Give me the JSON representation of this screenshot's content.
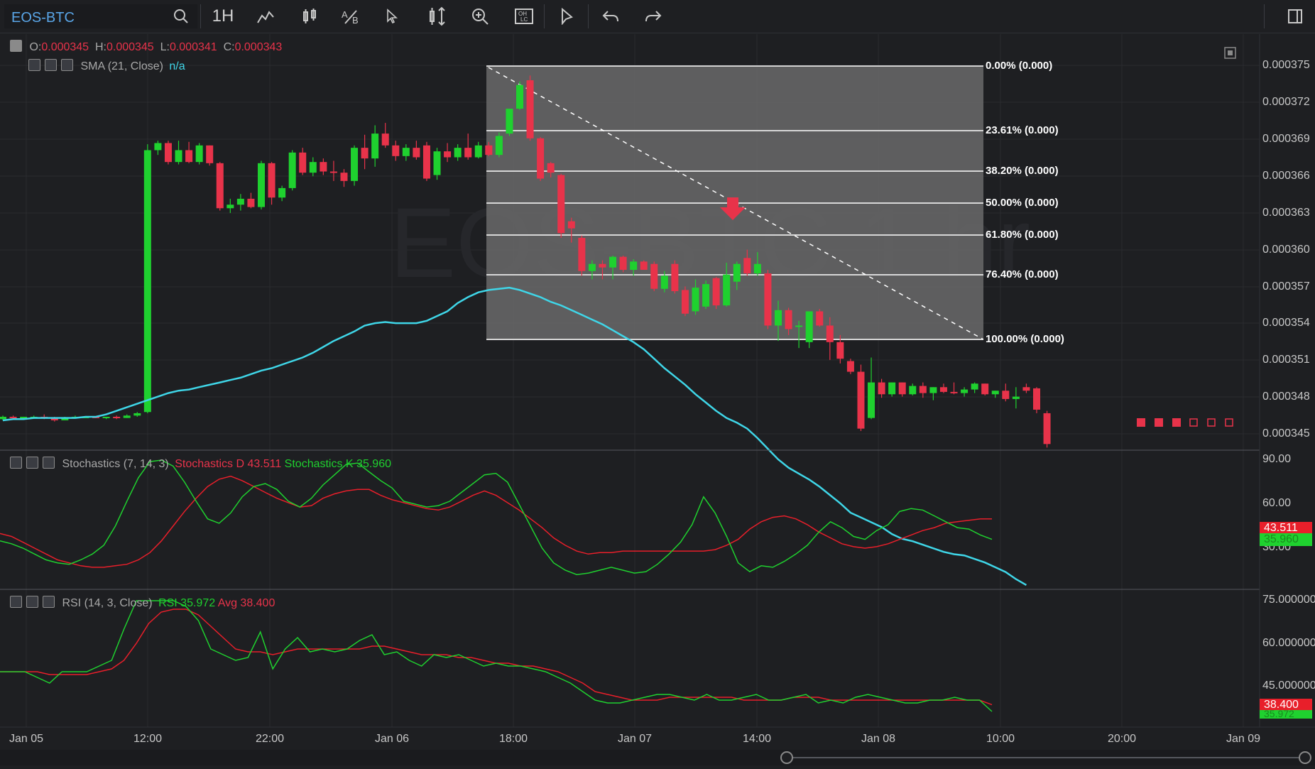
{
  "toolbar": {
    "symbol": "EOS-BTC",
    "interval": "1H",
    "icons": [
      "search-icon",
      "line-study-icon",
      "candle-style-icon",
      "text-annotation-icon",
      "cursor-icon",
      "y-scale-icon",
      "zoom-in-icon",
      "ohlc-icon",
      "pointer-icon",
      "undo-icon",
      "redo-icon",
      "fullscreen-icon"
    ]
  },
  "watermark": "EOS-BTC 1 hr",
  "ohlc": {
    "o_label": "O:",
    "o_value": "0.000345",
    "h_label": "H:",
    "h_value": "0.000345",
    "l_label": "L:",
    "l_value": "0.000341",
    "c_label": "C:",
    "c_value": "0.000343"
  },
  "sma": {
    "label": "SMA (21, Close)",
    "value": "n/a"
  },
  "price_axis": [
    "0.000375",
    "0.000372",
    "0.000369",
    "0.000366",
    "0.000363",
    "0.000360",
    "0.000357",
    "0.000354",
    "0.000351",
    "0.000348",
    "0.000345"
  ],
  "fib_levels": [
    "0.00% (0.000)",
    "23.61% (0.000)",
    "38.20% (0.000)",
    "50.00% (0.000)",
    "61.80% (0.000)",
    "76.40% (0.000)",
    "100.00% (0.000)"
  ],
  "stochastics": {
    "label": "Stochastics (7, 14, 3)",
    "d_label": "Stochastics D 43.511",
    "k_label": "Stochastics K 35.960",
    "axis": [
      "90.00",
      "60.00",
      "30.00"
    ],
    "d_tag": "43.511",
    "k_tag": "35.960"
  },
  "rsi": {
    "label": "RSI (14, 3, Close)",
    "rsi_label": "RSI 35.972",
    "avg_label": "Avg 38.400",
    "axis": [
      "75.000000",
      "60.000000",
      "45.000000"
    ],
    "avg_tag": "38.400",
    "rsi_tag": "35.972"
  },
  "time_axis": [
    "Jan 05",
    "12:00",
    "22:00",
    "Jan 06",
    "18:00",
    "Jan 07",
    "14:00",
    "Jan 08",
    "10:00",
    "20:00",
    "Jan 09"
  ],
  "colors": {
    "up": "#1fd12f",
    "down": "#e8334a",
    "sma": "#3fd6e8",
    "bg": "#1e1f22"
  },
  "chart_data": {
    "type": "candlestick",
    "candles": [
      [
        0.0003459,
        0.0003462,
        0.0003458,
        0.0003461
      ],
      [
        0.0003461,
        0.0003462,
        0.000346,
        0.000346
      ],
      [
        0.000346,
        0.0003461,
        0.0003459,
        0.0003461
      ],
      [
        0.0003461,
        0.0003462,
        0.000346,
        0.0003461
      ],
      [
        0.0003461,
        0.0003463,
        0.0003459,
        0.000346
      ],
      [
        0.000346,
        0.0003461,
        0.0003457,
        0.0003458
      ],
      [
        0.0003458,
        0.0003461,
        0.0003458,
        0.000346
      ],
      [
        0.000346,
        0.0003462,
        0.000346,
        0.0003461
      ],
      [
        0.0003461,
        0.0003461,
        0.000346,
        0.0003461
      ],
      [
        0.0003461,
        0.0003461,
        0.000346,
        0.000346
      ],
      [
        0.000346,
        0.0003461,
        0.0003459,
        0.0003461
      ],
      [
        0.0003461,
        0.0003462,
        0.0003459,
        0.000346
      ],
      [
        0.000346,
        0.0003463,
        0.000346,
        0.0003462
      ],
      [
        0.0003462,
        0.0003465,
        0.0003461,
        0.0003464
      ],
      [
        0.0003465,
        0.0003691,
        0.0003464,
        0.0003686
      ],
      [
        0.0003686,
        0.0003694,
        0.0003682,
        0.0003692
      ],
      [
        0.0003692,
        0.0003694,
        0.0003674,
        0.0003676
      ],
      [
        0.0003676,
        0.0003694,
        0.0003674,
        0.0003686
      ],
      [
        0.0003686,
        0.0003693,
        0.0003675,
        0.0003676
      ],
      [
        0.0003676,
        0.0003692,
        0.0003674,
        0.000369
      ],
      [
        0.000369,
        0.000369,
        0.0003673,
        0.0003675
      ],
      [
        0.0003675,
        0.0003676,
        0.0003635,
        0.0003637
      ],
      [
        0.0003637,
        0.0003645,
        0.0003633,
        0.000364
      ],
      [
        0.000364,
        0.0003649,
        0.0003635,
        0.0003645
      ],
      [
        0.0003645,
        0.000365,
        0.0003637,
        0.0003638
      ],
      [
        0.0003638,
        0.0003677,
        0.0003636,
        0.0003675
      ],
      [
        0.0003675,
        0.0003676,
        0.000364,
        0.0003646
      ],
      [
        0.0003646,
        0.0003656,
        0.0003643,
        0.0003654
      ],
      [
        0.0003654,
        0.0003686,
        0.0003652,
        0.0003684
      ],
      [
        0.0003684,
        0.0003688,
        0.0003665,
        0.0003667
      ],
      [
        0.0003667,
        0.000368,
        0.0003664,
        0.0003676
      ],
      [
        0.0003676,
        0.0003679,
        0.0003665,
        0.0003668
      ],
      [
        0.0003668,
        0.0003677,
        0.000366,
        0.0003667
      ],
      [
        0.0003667,
        0.000367,
        0.0003655,
        0.000366
      ],
      [
        0.000366,
        0.000369,
        0.0003656,
        0.0003688
      ],
      [
        0.0003688,
        0.0003699,
        0.000367,
        0.0003679
      ],
      [
        0.0003679,
        0.0003707,
        0.0003672,
        0.00037
      ],
      [
        0.00037,
        0.0003709,
        0.0003688,
        0.000369
      ],
      [
        0.000369,
        0.0003694,
        0.0003677,
        0.0003681
      ],
      [
        0.0003681,
        0.0003691,
        0.0003677,
        0.0003688
      ],
      [
        0.0003688,
        0.0003694,
        0.0003678,
        0.000368
      ],
      [
        0.000369,
        0.0003693,
        0.000366,
        0.0003662
      ],
      [
        0.0003665,
        0.0003688,
        0.0003661,
        0.0003685
      ],
      [
        0.0003685,
        0.0003692,
        0.0003676,
        0.000368
      ],
      [
        0.000368,
        0.0003691,
        0.0003677,
        0.0003688
      ],
      [
        0.0003688,
        0.00037,
        0.0003678,
        0.000368
      ],
      [
        0.000368,
        0.0003693,
        0.0003679,
        0.000369
      ],
      [
        0.000369,
        0.0003693,
        0.0003681,
        0.0003682
      ],
      [
        0.0003682,
        0.0003701,
        0.000368,
        0.0003698
      ],
      [
        0.00037,
        0.0003712,
        0.0003698,
        0.0003721
      ],
      [
        0.0003721,
        0.0003744,
        0.000372,
        0.0003741
      ],
      [
        0.0003745,
        0.0003749,
        0.0003694,
        0.0003696
      ],
      [
        0.0003696,
        0.0003697,
        0.000366,
        0.0003662
      ],
      [
        0.0003675,
        0.0003676,
        0.0003663,
        0.0003667
      ],
      [
        0.0003665,
        0.0003666,
        0.0003612,
        0.0003616
      ],
      [
        0.0003626,
        0.0003629,
        0.0003608,
        0.000362
      ],
      [
        0.0003612,
        0.0003614,
        0.000358,
        0.0003584
      ],
      [
        0.0003584,
        0.0003593,
        0.0003577,
        0.000359
      ],
      [
        0.000359,
        0.0003593,
        0.0003577,
        0.0003587
      ],
      [
        0.0003587,
        0.0003597,
        0.0003577,
        0.0003596
      ],
      [
        0.0003596,
        0.0003597,
        0.0003583,
        0.0003585
      ],
      [
        0.0003585,
        0.0003594,
        0.000358,
        0.0003592
      ],
      [
        0.0003592,
        0.0003593,
        0.0003585,
        0.0003585
      ],
      [
        0.000359,
        0.0003592,
        0.0003567,
        0.0003569
      ],
      [
        0.0003569,
        0.0003584,
        0.0003566,
        0.000358
      ],
      [
        0.000359,
        0.0003593,
        0.0003565,
        0.0003567
      ],
      [
        0.0003568,
        0.0003571,
        0.0003546,
        0.0003548
      ],
      [
        0.000355,
        0.0003577,
        0.0003547,
        0.000357
      ],
      [
        0.0003554,
        0.0003576,
        0.0003552,
        0.0003573
      ],
      [
        0.0003578,
        0.0003579,
        0.0003552,
        0.0003555
      ],
      [
        0.0003555,
        0.0003591,
        0.0003554,
        0.0003581
      ],
      [
        0.0003575,
        0.0003592,
        0.0003568,
        0.000359
      ],
      [
        0.0003595,
        0.0003602,
        0.000358,
        0.0003582
      ],
      [
        0.0003582,
        0.00036,
        0.000358,
        0.000359
      ],
      [
        0.0003582,
        0.0003585,
        0.0003535,
        0.0003538
      ],
      [
        0.0003538,
        0.0003559,
        0.0003525,
        0.0003551
      ],
      [
        0.0003551,
        0.0003553,
        0.000353,
        0.0003535
      ],
      [
        0.0003537,
        0.0003542,
        0.0003519,
        0.0003538
      ],
      [
        0.0003524,
        0.0003545,
        0.0003519,
        0.000355
      ],
      [
        0.000355,
        0.0003552,
        0.0003537,
        0.0003538
      ],
      [
        0.0003538,
        0.0003545,
        0.0003509,
        0.0003524
      ],
      [
        0.0003524,
        0.000353,
        0.0003506,
        0.000351
      ],
      [
        0.0003508,
        0.000351,
        0.0003497,
        0.0003499
      ],
      [
        0.0003499,
        0.0003505,
        0.0003449,
        0.0003451
      ],
      [
        0.000346,
        0.0003511,
        0.0003459,
        0.000349
      ],
      [
        0.000349,
        0.0003493,
        0.0003477,
        0.000348
      ],
      [
        0.000348,
        0.000349,
        0.0003478,
        0.000349
      ],
      [
        0.000349,
        0.000349,
        0.0003478,
        0.000348
      ],
      [
        0.000348,
        0.0003489,
        0.0003479,
        0.0003487
      ],
      [
        0.0003487,
        0.000349,
        0.0003477,
        0.0003481
      ],
      [
        0.0003481,
        0.0003486,
        0.0003475,
        0.0003486
      ],
      [
        0.0003486,
        0.0003489,
        0.0003481,
        0.0003482
      ],
      [
        0.0003482,
        0.000349,
        0.000348,
        0.0003481
      ],
      [
        0.0003481,
        0.0003486,
        0.0003478,
        0.0003484
      ],
      [
        0.0003484,
        0.000349,
        0.0003481,
        0.0003489
      ],
      [
        0.0003489,
        0.0003489,
        0.0003479,
        0.000348
      ],
      [
        0.000348,
        0.0003483,
        0.0003477,
        0.0003483
      ],
      [
        0.0003483,
        0.0003489,
        0.0003474,
        0.0003476
      ],
      [
        0.0003476,
        0.0003486,
        0.0003468,
        0.0003478
      ],
      [
        0.0003486,
        0.0003489,
        0.0003481,
        0.0003483
      ],
      [
        0.0003485,
        0.0003486,
        0.0003464,
        0.0003467
      ],
      [
        0.0003464,
        0.0003466,
        0.0003435,
        0.0003438
      ]
    ],
    "sma": [
      0.0003458,
      0.0003459,
      0.0003459,
      0.000346,
      0.000346,
      0.000346,
      0.000346,
      0.000346,
      0.0003461,
      0.0003461,
      0.0003463,
      0.0003466,
      0.0003469,
      0.0003472,
      0.0003475,
      0.0003478,
      0.0003481,
      0.0003483,
      0.0003484,
      0.0003486,
      0.0003488,
      0.000349,
      0.0003492,
      0.0003494,
      0.0003497,
      0.00035,
      0.0003502,
      0.0003505,
      0.0003508,
      0.0003511,
      0.0003515,
      0.000352,
      0.0003525,
      0.0003529,
      0.0003533,
      0.0003538,
      0.000354,
      0.0003541,
      0.000354,
      0.000354,
      0.000354,
      0.0003542,
      0.0003546,
      0.000355,
      0.0003557,
      0.0003562,
      0.0003566,
      0.0003568,
      0.0003569,
      0.000357,
      0.0003568,
      0.0003565,
      0.0003562,
      0.0003558,
      0.0003555,
      0.0003551,
      0.0003547,
      0.0003543,
      0.0003539,
      0.0003534,
      0.0003529,
      0.0003524,
      0.0003518,
      0.000351,
      0.0003502,
      0.0003495,
      0.0003488,
      0.000348,
      0.0003473,
      0.0003466,
      0.000346,
      0.0003456,
      0.0003451,
      0.0003443,
      0.0003434,
      0.0003425,
      0.0003418,
      0.0003413,
      0.0003408,
      0.0003402,
      0.0003395,
      0.0003388,
      0.000338,
      0.0003376,
      0.0003372,
      0.0003368,
      0.0003362,
      0.0003358,
      0.0003356,
      0.0003353,
      0.000335,
      0.0003347,
      0.0003345,
      0.0003344,
      0.0003341,
      0.0003338,
      0.0003334,
      0.000333,
      0.0003324,
      0.0003319
    ],
    "price_range": [
      0.000344,
      0.0003757
    ],
    "stoch_d": [
      40,
      38,
      34,
      30,
      26,
      22,
      20,
      18,
      17,
      17,
      18,
      19,
      22,
      27,
      35,
      45,
      55,
      64,
      72,
      77,
      79,
      76,
      72,
      68,
      64,
      61,
      58,
      59,
      64,
      67,
      69,
      70,
      70,
      66,
      63,
      61,
      59,
      57,
      56,
      58,
      62,
      66,
      69,
      66,
      61,
      56,
      50,
      44,
      37,
      32,
      28,
      26,
      27,
      27,
      28,
      28,
      28,
      28,
      28,
      28,
      28,
      28,
      29,
      32,
      36,
      43,
      48,
      51,
      52,
      50,
      46,
      41,
      37,
      33,
      31,
      30,
      31,
      33,
      36,
      39,
      42,
      44,
      47,
      48,
      49,
      50,
      50
    ],
    "stoch_k": [
      35,
      33,
      30,
      26,
      22,
      20,
      19,
      22,
      26,
      32,
      45,
      62,
      78,
      89,
      90,
      86,
      75,
      62,
      50,
      47,
      54,
      65,
      72,
      74,
      70,
      62,
      58,
      64,
      73,
      80,
      87,
      88,
      82,
      76,
      71,
      62,
      60,
      58,
      59,
      62,
      68,
      74,
      80,
      81,
      75,
      60,
      45,
      30,
      20,
      15,
      12,
      13,
      15,
      17,
      15,
      13,
      14,
      19,
      26,
      34,
      46,
      65,
      54,
      38,
      20,
      14,
      18,
      17,
      21,
      26,
      32,
      41,
      48,
      44,
      38,
      36,
      42,
      46,
      55,
      57,
      56,
      52,
      48,
      44,
      43,
      39,
      36
    ],
    "rsi": [
      50,
      50,
      50,
      48,
      46,
      50,
      50,
      50,
      52,
      54,
      65,
      75,
      75,
      75,
      75,
      73,
      68,
      58,
      56,
      54,
      55,
      64,
      51,
      58,
      62,
      57,
      58,
      57,
      58,
      61,
      63,
      56,
      57,
      54,
      52,
      56,
      55,
      56,
      54,
      52,
      53,
      52,
      52,
      51,
      50,
      48,
      46,
      43,
      40,
      39,
      39,
      40,
      41,
      42,
      42,
      41,
      40,
      42,
      40,
      40,
      41,
      42,
      40,
      40,
      41,
      42,
      39,
      40,
      39,
      41,
      42,
      41,
      40,
      39,
      39,
      40,
      40,
      41,
      40,
      40,
      36
    ],
    "rsi_avg": [
      50,
      50,
      50,
      50,
      49,
      49,
      49,
      49,
      50,
      51,
      54,
      60,
      67,
      71,
      72,
      72,
      70,
      66,
      62,
      58,
      57,
      57,
      56,
      57,
      58,
      58,
      58,
      58,
      58,
      58,
      59,
      59,
      58,
      57,
      56,
      56,
      56,
      55,
      55,
      54,
      53,
      53,
      52,
      52,
      51,
      50,
      48,
      46,
      43,
      42,
      41,
      40,
      40,
      40,
      41,
      41,
      41,
      41,
      41,
      41,
      40,
      40,
      40,
      40,
      41,
      41,
      41,
      40,
      40,
      40,
      40,
      40,
      40,
      40,
      40,
      40,
      40,
      40,
      40,
      40,
      38.4
    ]
  }
}
